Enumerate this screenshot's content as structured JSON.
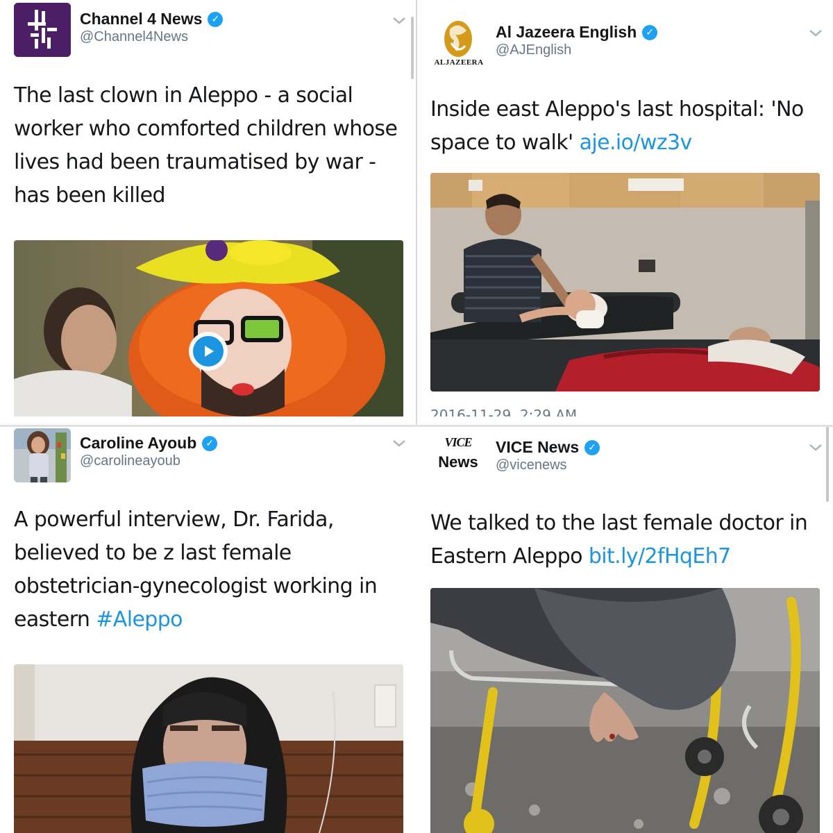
{
  "tweets": [
    {
      "display_name": "Channel 4 News",
      "handle": "@Channel4News",
      "avatar_icon": "channel4-logo-icon",
      "text": "The last clown in Aleppo - a social worker who comforted children whose lives had been traumatised by war - has been killed",
      "media": "video",
      "media_icon": "play-icon"
    },
    {
      "display_name": "Al Jazeera English",
      "handle": "@AJEnglish",
      "avatar_icon": "aljazeera-logo-icon",
      "avatar_caption": "ALJAZEERA",
      "text": "Inside east Aleppo's last hospital: 'No space to walk'",
      "link": "aje.io/wz3v",
      "media": "photo",
      "timestamp": "2016-11-29, 2:29 AM"
    },
    {
      "display_name": "Caroline Ayoub",
      "handle": "@carolineayoub",
      "text": "A powerful interview, Dr. Farida, believed to be z last female obstetrician-gynecologist working in eastern",
      "link": "#Aleppo",
      "media": "photo"
    },
    {
      "display_name": "VICE News",
      "handle": "@vicenews",
      "avatar_icon": "vice-news-logo-icon",
      "avatar_caption_top": "VICE",
      "avatar_caption_bottom": "News",
      "text": "We talked to the last female doctor in Eastern Aleppo",
      "link": "bit.ly/2fHqEh7",
      "media": "photo"
    }
  ],
  "colors": {
    "verified": "#1da1f2",
    "link": "#1b95e0",
    "handle": "#657786",
    "channel4_purple": "#4b1e66"
  },
  "icons": {
    "verified": "verified-badge-icon",
    "chevron": "chevron-down-icon"
  }
}
